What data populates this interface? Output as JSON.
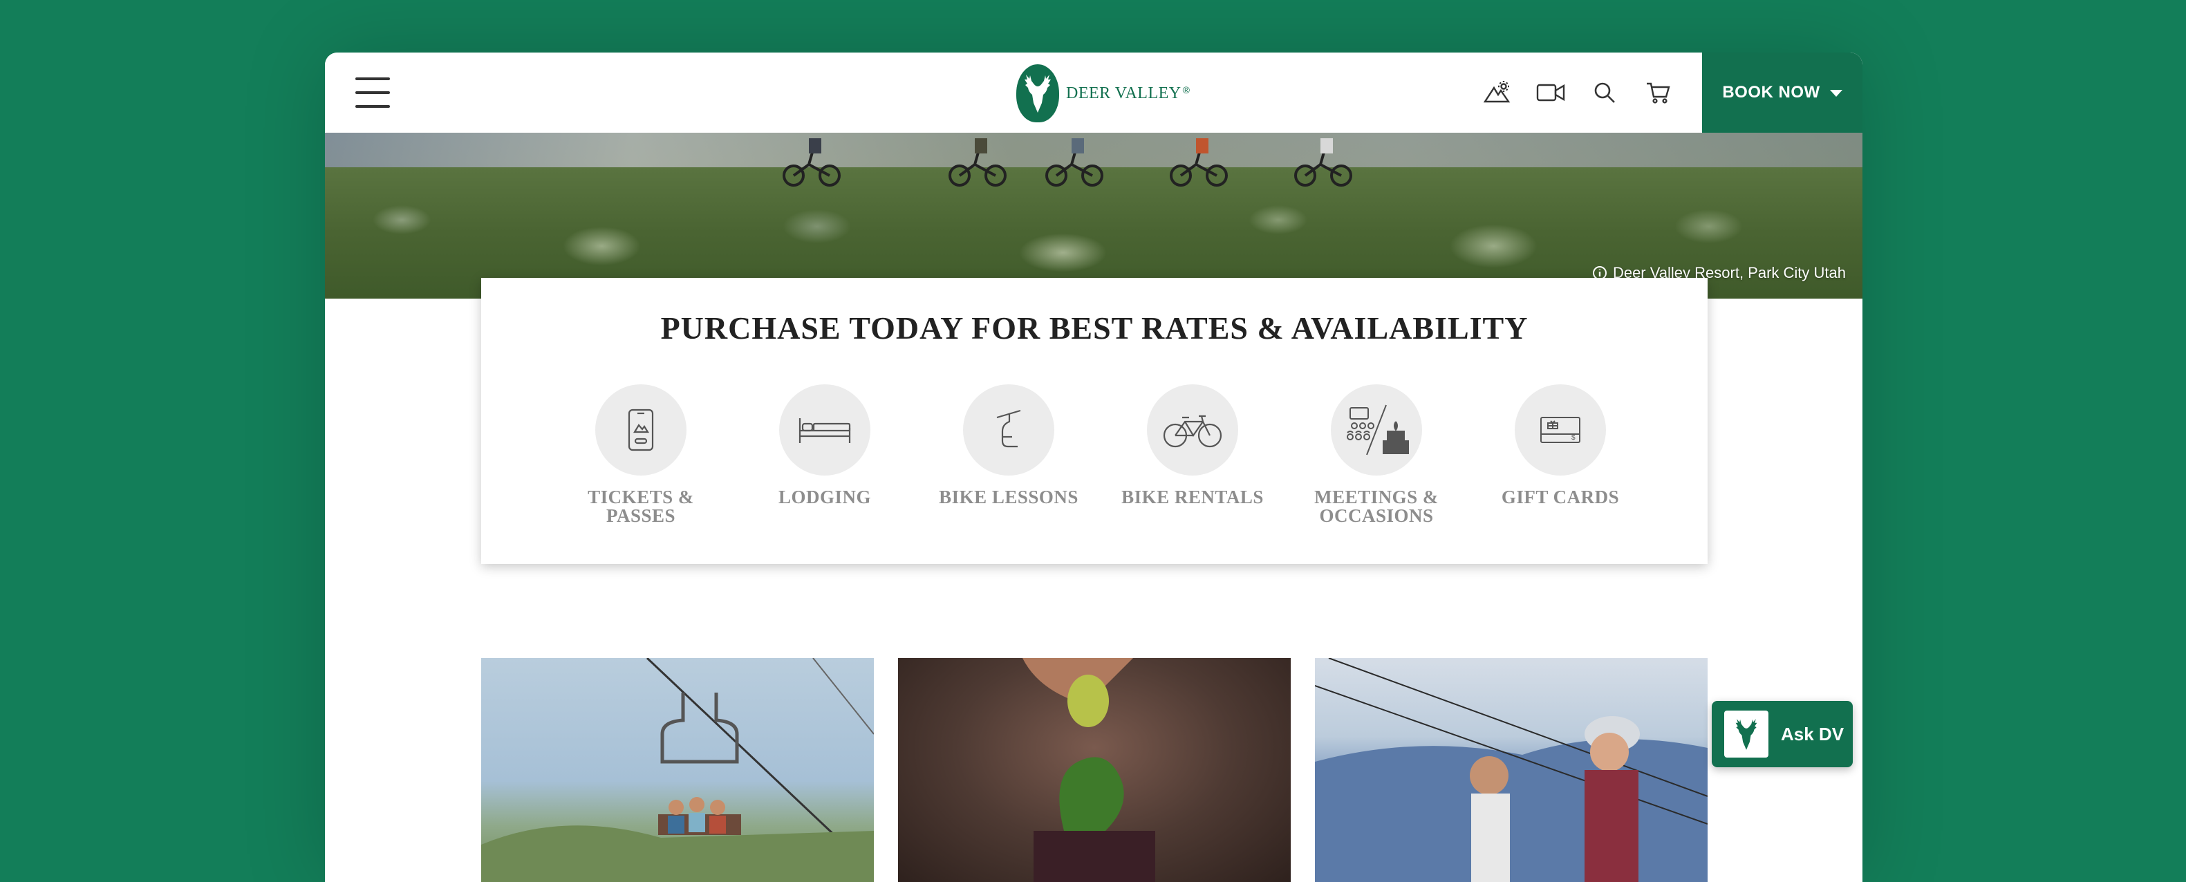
{
  "header": {
    "logo_text": "DEER VALLEY",
    "logo_mark": "®",
    "book_now_label": "BOOK NOW",
    "icons": [
      "weather-icon",
      "video-icon",
      "search-icon",
      "cart-icon"
    ]
  },
  "hero": {
    "location_label": "Deer Valley Resort, Park City Utah"
  },
  "booking": {
    "title": "PURCHASE TODAY FOR BEST RATES & AVAILABILITY",
    "options": [
      {
        "label": "TICKETS & PASSES",
        "icon": "ticket-phone-icon"
      },
      {
        "label": "LODGING",
        "icon": "bed-icon"
      },
      {
        "label": "BIKE LESSONS",
        "icon": "chairlift-icon"
      },
      {
        "label": "BIKE RENTALS",
        "icon": "bicycle-icon"
      },
      {
        "label": "MEETINGS & OCCASIONS",
        "icon": "meetings-cake-icon"
      },
      {
        "label": "GIFT CARDS",
        "icon": "gift-card-icon"
      }
    ]
  },
  "chat": {
    "label": "Ask DV"
  },
  "colors": {
    "brand_green": "#12704f",
    "page_background": "#137e59",
    "icon_circle": "#ececec",
    "option_label": "#8d8d8d"
  }
}
